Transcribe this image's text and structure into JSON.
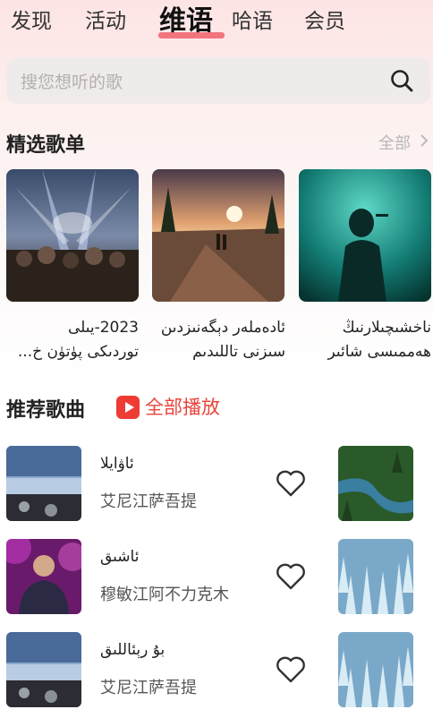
{
  "nav": {
    "tabs": [
      {
        "label": "发现"
      },
      {
        "label": "活动"
      },
      {
        "label": "维语"
      },
      {
        "label": "哈语"
      },
      {
        "label": "会员"
      }
    ],
    "active_index": 2
  },
  "search": {
    "placeholder": "搜您想听的歌",
    "icon": "search-icon"
  },
  "playlists": {
    "title": "精选歌单",
    "all_label": "全部",
    "items": [
      {
        "title_line1": "2023-يىلى",
        "title_line2": "توردىكى پۈتۈن خ...",
        "cover": "concert-crowd"
      },
      {
        "title_line1": "ئادەملەر دېگەنىزدىن",
        "title_line2": "سىزنى تاللىدىم",
        "cover": "sunset-couple"
      },
      {
        "title_line1": "ناخشىچىلارنىڭ",
        "title_line2": "ھەممىسى شائىر",
        "cover": "singer-stage"
      }
    ]
  },
  "songs": {
    "title": "推荐歌曲",
    "play_all_label": "全部播放",
    "items": [
      {
        "name": "ئاۋايلا",
        "artist": "艾尼江萨吾提",
        "icon": "heart-icon"
      },
      {
        "name": "ئاشىق",
        "artist": "穆敏江阿不力克木",
        "icon": "heart-icon"
      },
      {
        "name": "بۇ رېئاللىق",
        "artist": "艾尼江萨吾提",
        "icon": "heart-icon"
      }
    ]
  },
  "colors": {
    "accent": "#e8443b",
    "underline": "#f0606a"
  }
}
